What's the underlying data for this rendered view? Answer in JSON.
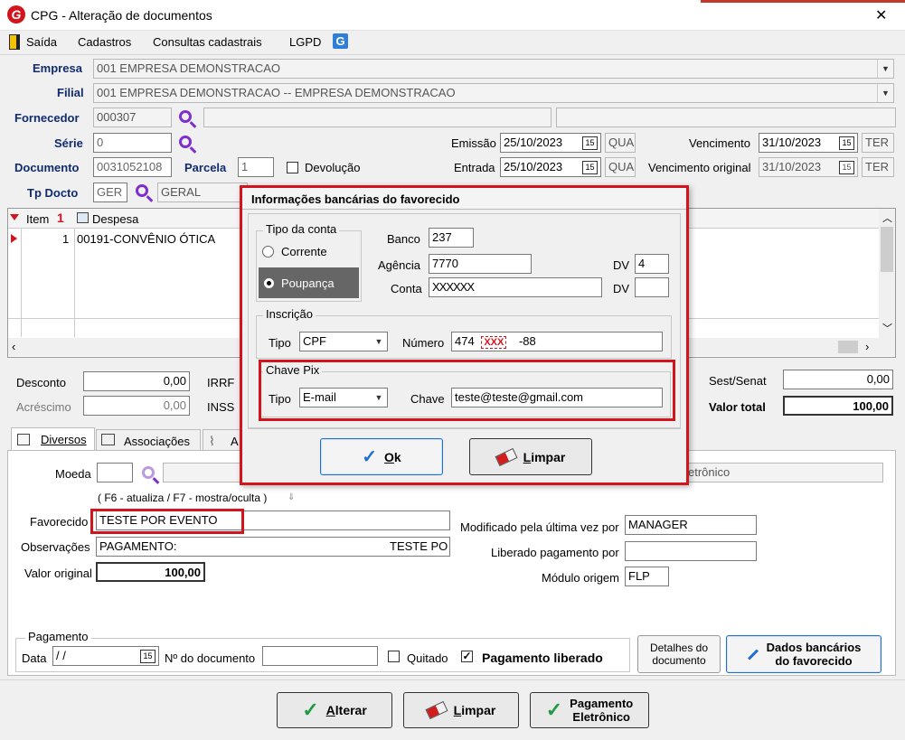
{
  "window": {
    "title": "CPG - Alteração de documentos",
    "close": "✕"
  },
  "menu": {
    "exit": "Saída",
    "register": "Cadastros",
    "consult": "Consultas cadastrais",
    "lgpd": "LGPD",
    "app_icon_letter": "G"
  },
  "header": {
    "company_label": "Empresa",
    "company_value": "001 EMPRESA DEMONSTRACAO",
    "branch_label": "Filial",
    "branch_value": "001 EMPRESA DEMONSTRACAO -- EMPRESA DEMONSTRACAO",
    "supplier_label": "Fornecedor",
    "supplier_value": "000307",
    "supplier_name": "",
    "supplier_extra": "",
    "series_label": "Série",
    "series_value": "0",
    "document_label": "Documento",
    "document_value": "0031052108",
    "installment_label": "Parcela",
    "installment_value": "1",
    "return_label": "Devolução",
    "doc_type_label": "Tp Docto",
    "doc_type_code": "GER",
    "doc_type_name": "GERAL",
    "issue_label": "Emissão",
    "issue_date": "25/10/2023",
    "issue_day": "QUA",
    "entry_label": "Entrada",
    "entry_date": "25/10/2023",
    "entry_day": "QUA",
    "due_label": "Vencimento",
    "due_date": "31/10/2023",
    "due_day": "TER",
    "orig_due_label": "Vencimento original",
    "orig_due_date": "31/10/2023",
    "orig_due_day": "TER",
    "cal_glyph": "15"
  },
  "grid": {
    "columns": {
      "item": "Item",
      "item_sort": "1",
      "expense": "Despesa"
    },
    "rows": [
      {
        "item": "1",
        "expense": "00191-CONVÊNIO ÓTICA"
      }
    ]
  },
  "totals": {
    "discount_label": "Desconto",
    "discount_value": "0,00",
    "addition_label": "Acréscimo",
    "addition_value": "0,00",
    "irrf_label": "IRRF",
    "inss_label": "INSS",
    "sest_label": "Sest/Senat",
    "sest_value": "0,00",
    "total_label": "Valor total",
    "total_value": "100,00"
  },
  "tabs": {
    "misc": "Diversos",
    "assoc": "Associações",
    "attach": "A"
  },
  "misc": {
    "currency_label": "Moeda",
    "currency_value": "",
    "currency_name": "",
    "right_readonly": "etrônico",
    "hint": "( F6 - atualiza / F7 - mostra/oculta )",
    "payee_label": "Favorecido",
    "payee_value": "TESTE POR EVENTO",
    "notes_label": "Observações",
    "notes_value": "PAGAMENTO:",
    "notes_value2": "TESTE PO",
    "orig_value_label": "Valor original",
    "orig_value": "100,00",
    "modified_label": "Modificado pela última vez por",
    "modified_value": "MANAGER",
    "released_by_label": "Liberado pagamento por",
    "released_by_value": "",
    "module_label": "Módulo origem",
    "module_value": "FLP"
  },
  "payment": {
    "group_label": "Pagamento",
    "date_label": "Data",
    "date_value": " /  /",
    "doc_no_label": "Nº do documento",
    "doc_no_value": "",
    "settled_label": "Quitado",
    "released_label": "Pagamento liberado",
    "details_btn_line1": "Detalhes do",
    "details_btn_line2": "documento",
    "bank_btn_line1": "Dados bancários",
    "bank_btn_line2": "do favorecido"
  },
  "bottom": {
    "alter_rest": "lterar",
    "alter_u": "A",
    "clear_rest": "impar",
    "clear_u": "L",
    "epay_line1": "Pagamento",
    "epay_line2": "Eletrônico"
  },
  "dialog": {
    "title": "Informações bancárias do favorecido",
    "account_type_group": "Tipo da conta",
    "checking": "Corrente",
    "savings": "Poupança",
    "bank_label": "Banco",
    "bank_value": "237",
    "agency_label": "Agência",
    "agency_value": "7770",
    "dv_label": "DV",
    "agency_dv": "4",
    "account_label": "Conta",
    "account_value": "XXXXXX",
    "account_dv": "",
    "registration_group": "Inscrição",
    "reg_type_label": "Tipo",
    "reg_type_value": "CPF",
    "reg_number_label": "Número",
    "reg_number_a": "474",
    "reg_number_mask": "XXX",
    "reg_number_b": "-88",
    "pix_group": "Chave Pix",
    "pix_type_label": "Tipo",
    "pix_type_value": "E-mail",
    "pix_key_label": "Chave",
    "pix_key_value": "teste@teste@gmail.com",
    "ok_u": "O",
    "ok_rest": "k",
    "clear_u": "L",
    "clear_rest": "impar"
  },
  "colors": {
    "highlight_red": "#d2151c",
    "label_blue": "#102b6e",
    "accent_blue": "#1e6fd0",
    "check_green": "#1f9a44"
  }
}
